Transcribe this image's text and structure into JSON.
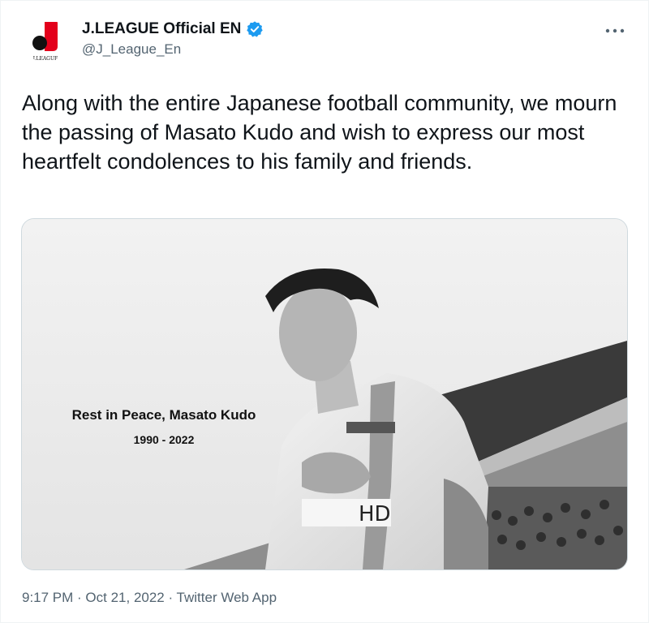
{
  "author": {
    "display_name": "J.LEAGUE Official EN",
    "handle": "@J_League_En",
    "avatar_caption": "J.LEAGUE"
  },
  "tweet": {
    "text": "Along with the entire Japanese football community, we mourn the passing of Masato Kudo and wish to express our most heartfelt condolences to his family and friends."
  },
  "media": {
    "rip_title": "Rest in Peace, Masato Kudo",
    "rip_years": "1990 - 2022",
    "jersey_sponsor": "HD"
  },
  "meta": {
    "timestamp": "9:17 PM · Oct 21, 2022 · Twitter Web App"
  },
  "icons": {
    "more": "more-horizontal-icon",
    "verified": "verified-badge-icon"
  },
  "colors": {
    "verified": "#1d9bf0",
    "secondary_text": "#536471",
    "logo_red": "#e3001b"
  }
}
